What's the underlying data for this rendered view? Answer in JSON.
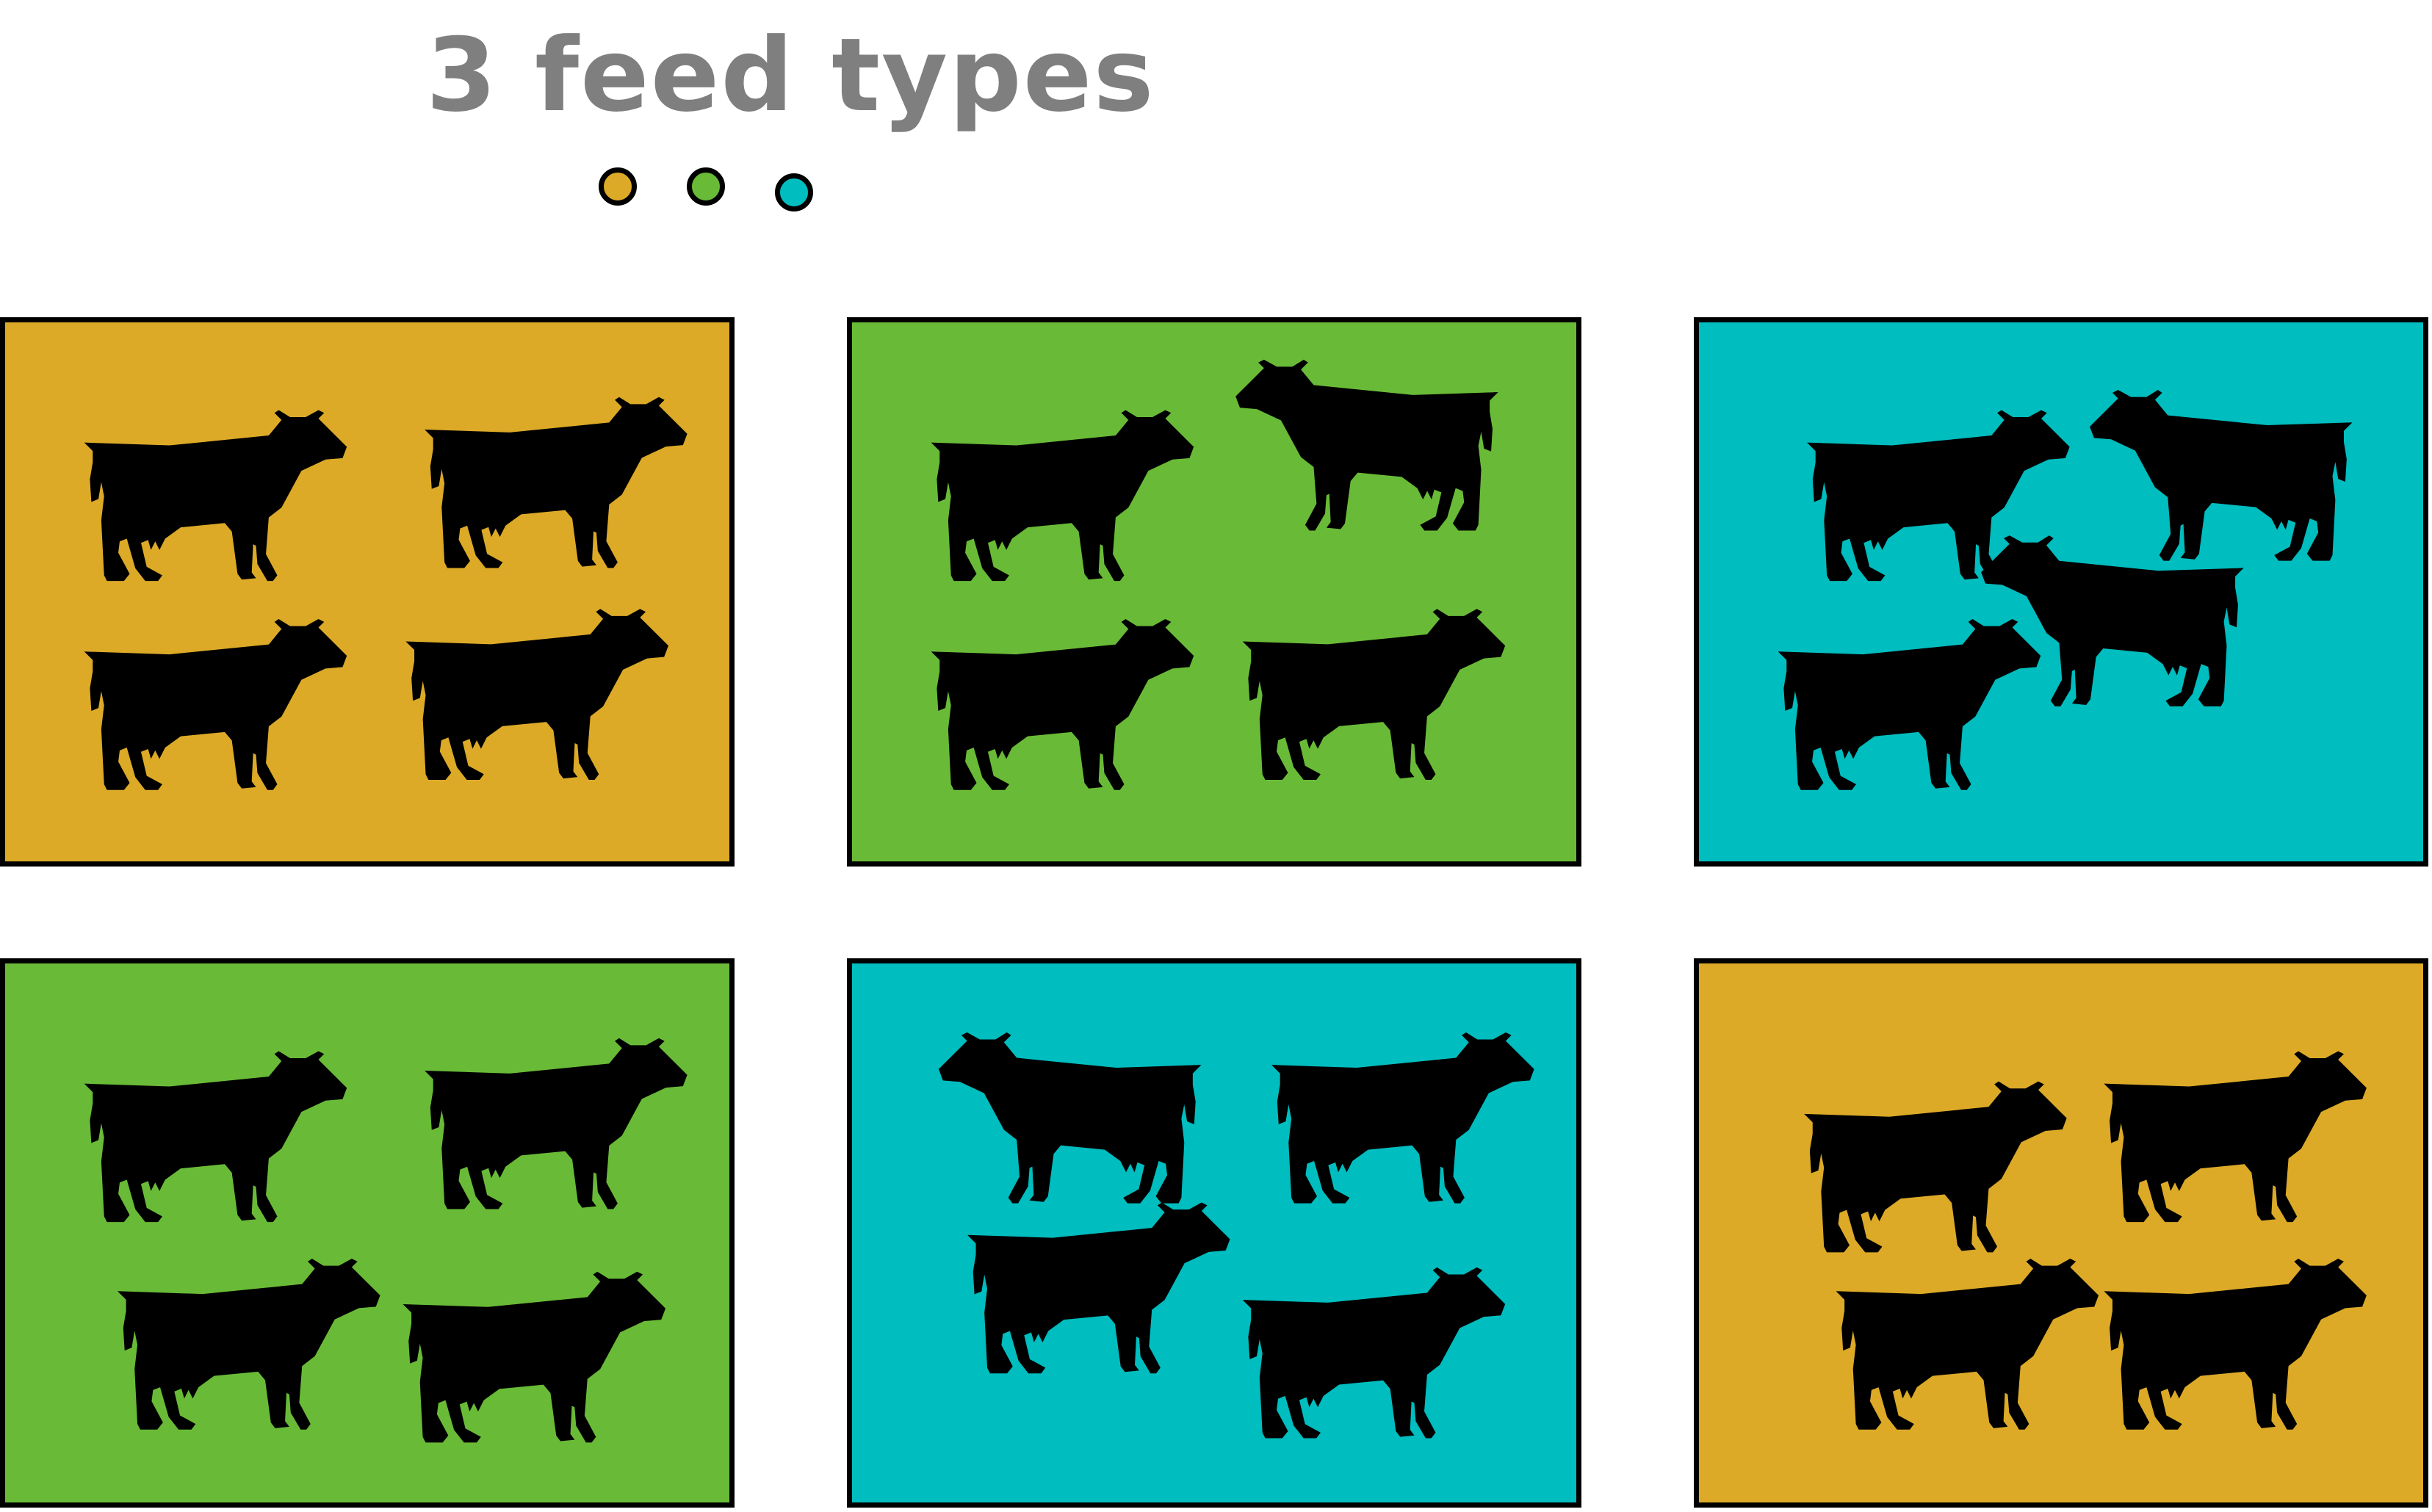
{
  "title": "3 feed types",
  "feed_colors": [
    "#dcaa27",
    "#69bb37",
    "#00bdbf"
  ],
  "legend": [
    {
      "feed": 1,
      "color": "#dcaa27"
    },
    {
      "feed": 2,
      "color": "#69bb37"
    },
    {
      "feed": 3,
      "color": "#00bdbf"
    }
  ],
  "pens": [
    {
      "row": 1,
      "column": 1,
      "feed": 1,
      "color": "#dcaa27",
      "cow_count": 4,
      "icon": "cow-icon"
    },
    {
      "row": 1,
      "column": 2,
      "feed": 2,
      "color": "#69bb37",
      "cow_count": 4,
      "icon": "cow-icon"
    },
    {
      "row": 1,
      "column": 3,
      "feed": 3,
      "color": "#00bdbf",
      "cow_count": 4,
      "icon": "cow-icon"
    },
    {
      "row": 2,
      "column": 1,
      "feed": 2,
      "color": "#69bb37",
      "cow_count": 4,
      "icon": "cow-icon"
    },
    {
      "row": 2,
      "column": 2,
      "feed": 3,
      "color": "#00bdbf",
      "cow_count": 4,
      "icon": "cow-icon"
    },
    {
      "row": 2,
      "column": 3,
      "feed": 1,
      "color": "#dcaa27",
      "cow_count": 4,
      "icon": "cow-icon"
    }
  ]
}
